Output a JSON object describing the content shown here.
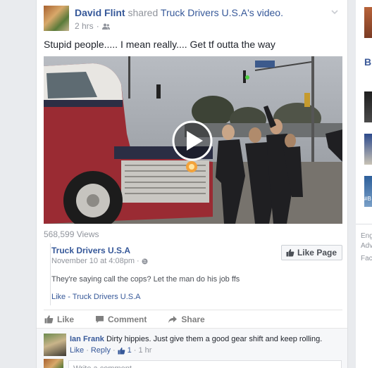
{
  "post": {
    "author": "David Flint",
    "verb": " shared ",
    "source_page": "Truck Drivers U.S.A",
    "source_suffix": "'s video.",
    "time": "2 hrs",
    "privacy_icon": "friends-icon",
    "caption": "Stupid people..... I mean really.... Get tf outta the way",
    "views": "568,599 Views"
  },
  "shared": {
    "page_name": "Truck Drivers U.S.A",
    "date": "November 10 at 4:08pm",
    "date_sep": " · ",
    "like_page_label": "Like Page",
    "text": "They're saying call the cops? Let the man do his job ffs",
    "like_link": "Like - Truck Drivers U.S.A"
  },
  "actions": {
    "like": "Like",
    "comment": "Comment",
    "share": "Share"
  },
  "comment": {
    "author": "Ian Frank",
    "text": " Dirty hippies. Just give them a good gear shift and keep rolling.",
    "like": "Like",
    "reply": "Reply",
    "sep": " · ",
    "like_count": "1",
    "time": "1 hr"
  },
  "composer": {
    "placeholder": "Write a comment..."
  },
  "right_column": {
    "item_b": "B",
    "hashtag_fragment": "#B",
    "footer_1": "Eng",
    "footer_2": "Adv",
    "footer_3": "Fac"
  },
  "colors": {
    "link": "#365899",
    "muted": "#90949c",
    "background": "#e9ebee"
  }
}
